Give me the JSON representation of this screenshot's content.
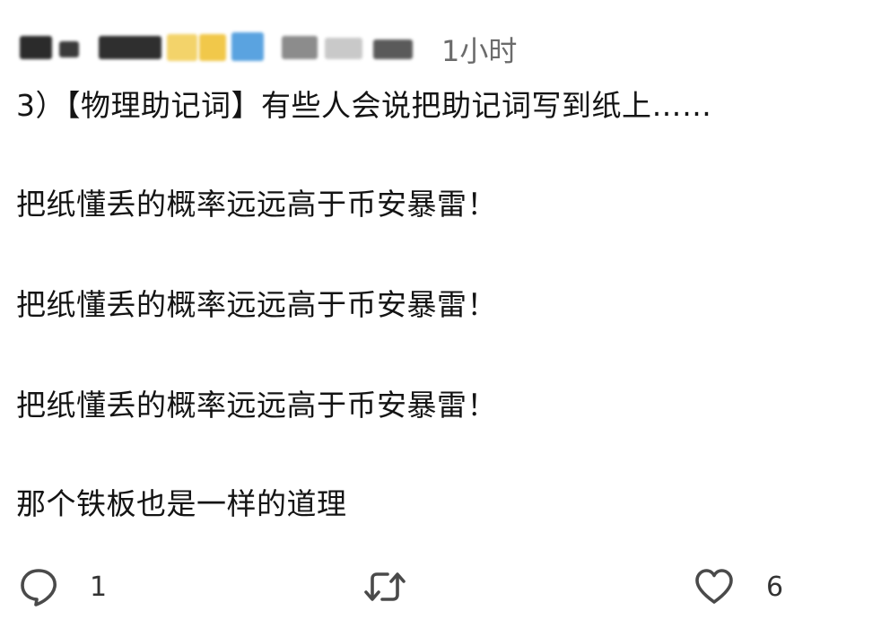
{
  "post": {
    "author_redacted": true,
    "timestamp": "1小时",
    "lines": [
      "3）【物理助记词】有些人会说把助记词写到纸上……",
      "把纸懂丢的概率远远高于币安暴雷！",
      "把纸懂丢的概率远远高于币安暴雷！",
      "把纸懂丢的概率远远高于币安暴雷！",
      "那个铁板也是一样的道理"
    ]
  },
  "actions": {
    "reply": {
      "icon": "reply-bubble-icon",
      "count": "1"
    },
    "retweet": {
      "icon": "retweet-icon",
      "count": ""
    },
    "like": {
      "icon": "heart-icon",
      "count": "6"
    }
  },
  "colors": {
    "text": "#141414",
    "muted": "#6b6b6b",
    "icon": "#4a4a4a",
    "background": "#ffffff"
  }
}
